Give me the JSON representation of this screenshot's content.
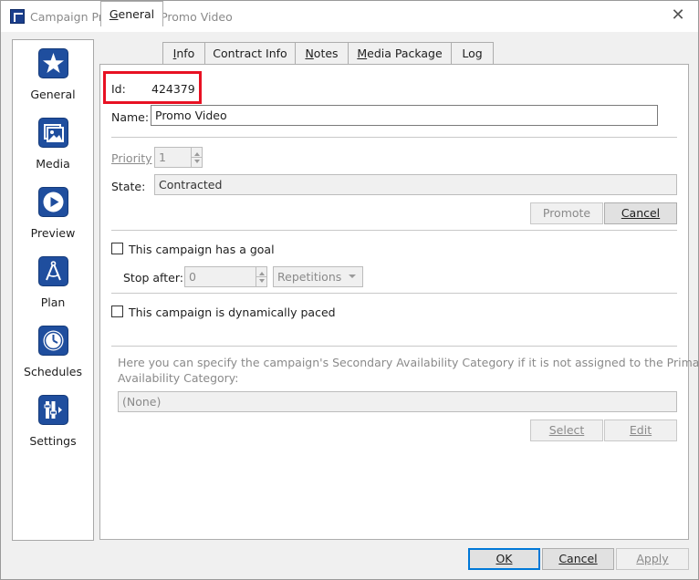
{
  "window": {
    "title": "Campaign Properties - Promo Video",
    "close_glyph": "✕"
  },
  "nav": {
    "items": [
      {
        "label": "General",
        "icon": "star-icon"
      },
      {
        "label": "Media",
        "icon": "media-icon"
      },
      {
        "label": "Preview",
        "icon": "play-icon"
      },
      {
        "label": "Plan",
        "icon": "compass-icon"
      },
      {
        "label": "Schedules",
        "icon": "clock-icon"
      },
      {
        "label": "Settings",
        "icon": "settings-icon"
      }
    ]
  },
  "tabs": [
    {
      "label": "General",
      "accesskey": "G",
      "rest": "eneral"
    },
    {
      "label": "Info",
      "accesskey": "I",
      "rest": "nfo"
    },
    {
      "label": "Contract Info"
    },
    {
      "label": "Notes",
      "accesskey": "N",
      "rest": "otes"
    },
    {
      "label": "Media Package",
      "accesskey": "M",
      "rest": "edia Package"
    },
    {
      "label": "Log"
    }
  ],
  "general": {
    "id_label": "Id:",
    "id_value": "424379",
    "name_label": "Name:",
    "name_value": "Promo Video",
    "priority_label": "Priority",
    "priority_value": "1",
    "state_label": "State:",
    "state_value": "Contracted",
    "promote_label": "Promote",
    "cancel_state_label": "Cancel",
    "goal_label": "This campaign has a goal",
    "stop_after_label": "Stop after:",
    "stop_after_value": "0",
    "repetitions_value": "Repetitions",
    "dynamic_label": "This campaign is dynamically paced",
    "secondary_text_1": "Here you can specify the campaign's Secondary Availability Category if it is not assigned to the Primary",
    "secondary_text_2": "Availability Category:",
    "category_value": "(None)",
    "select_label": "Select",
    "edit_label": "Edit"
  },
  "footer": {
    "ok_label": "OK",
    "cancel_label": "Cancel",
    "apply_label": "Apply"
  },
  "colors": {
    "highlight": "#e81123",
    "icon_blue": "#1f4e9e",
    "focus": "#0078d7"
  }
}
